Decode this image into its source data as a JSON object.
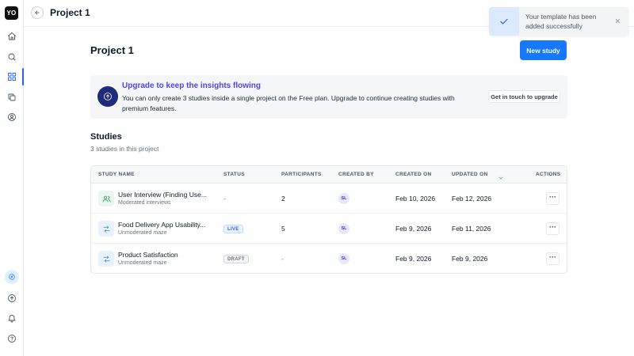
{
  "sidebar": {
    "logo": "YO",
    "top_icons": [
      "home-icon",
      "search-icon",
      "grid-icon",
      "copy-icon",
      "user-search-icon"
    ],
    "bottom_icons": [
      "compass-icon",
      "upload-icon",
      "bell-icon",
      "help-icon"
    ]
  },
  "topbar": {
    "title": "Project 1"
  },
  "toast": {
    "message": "Your template has been added successfully"
  },
  "page": {
    "title": "Project 1",
    "new_study_label": "New study"
  },
  "banner": {
    "title": "Upgrade to keep the insights flowing",
    "body": "You can only create 3 studies inside a single project on the Free plan. Upgrade to continue creating studies with premium features.",
    "button_label": "Get in touch to upgrade"
  },
  "studies": {
    "title": "Studies",
    "subtitle": "3 studies in this project",
    "columns": {
      "name": "STUDY NAME",
      "status": "STATUS",
      "participants": "PARTICIPANTS",
      "created_by": "CREATED BY",
      "created_on": "CREATED ON",
      "updated_on": "UPDATED ON",
      "actions": "ACTIONS"
    },
    "rows": [
      {
        "name": "User Interview (Finding Use...",
        "type": "Moderated interviews",
        "status": "-",
        "participants": "2",
        "created_by": "SL",
        "created_on": "Feb 10, 2026",
        "updated_on": "Feb 12, 2026",
        "actions": "···"
      },
      {
        "name": "Food Delivery App Usability...",
        "type": "Unmoderated maze",
        "status": "LIVE",
        "participants": "5",
        "created_by": "SL",
        "created_on": "Feb 9, 2026",
        "updated_on": "Feb 11, 2026",
        "actions": "···"
      },
      {
        "name": "Product Satisfaction",
        "type": "Unmoderated maze",
        "status": "DRAFT",
        "participants": "-",
        "created_by": "SL",
        "created_on": "Feb 9, 2026",
        "updated_on": "Feb 9, 2026",
        "actions": "···"
      }
    ]
  },
  "colors": {
    "accent": "#1677ff",
    "banner_title": "#4f46e5",
    "banner_icon_bg": "#1e2b7a",
    "live": "#2563eb",
    "interview_icon": "#16a34a",
    "maze_icon": "#2b89c8"
  }
}
